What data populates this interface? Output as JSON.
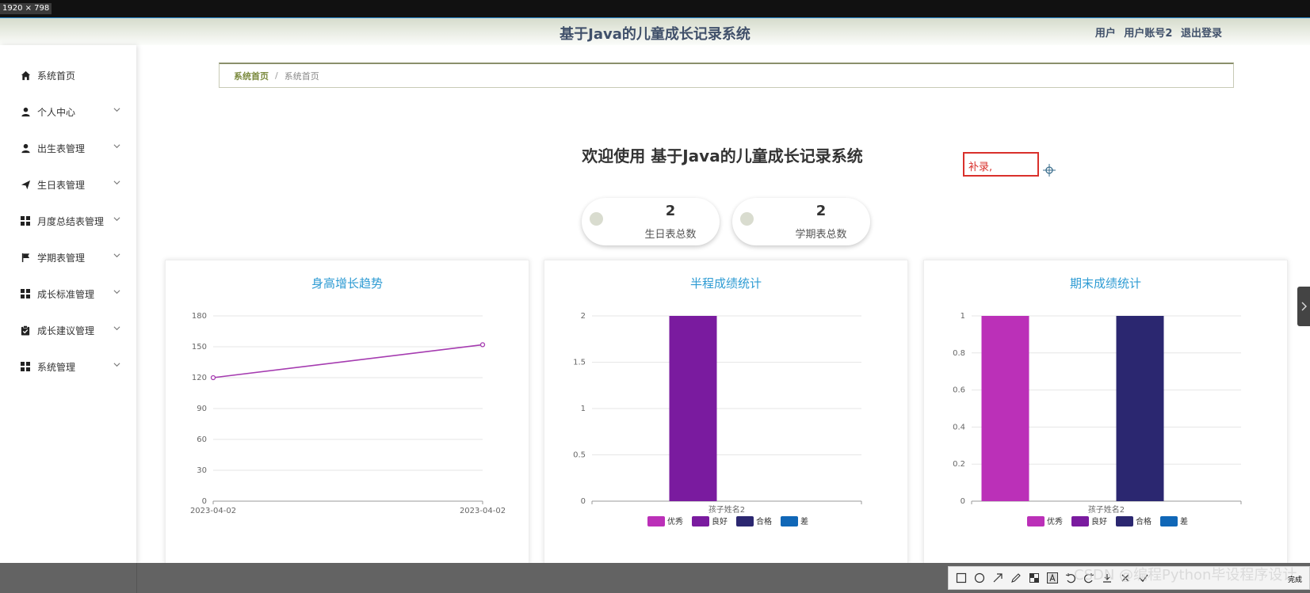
{
  "screen": {
    "size_label": "1920 × 798"
  },
  "header": {
    "title": "基于Java的儿童成长记录系统",
    "user_role": "用户",
    "user_account": "用户账号2",
    "logout": "退出登录"
  },
  "sidebar": {
    "items": [
      {
        "label": "系统首页",
        "icon": "home-icon"
      },
      {
        "label": "个人中心",
        "icon": "user-icon"
      },
      {
        "label": "出生表管理",
        "icon": "user-icon"
      },
      {
        "label": "生日表管理",
        "icon": "send-icon"
      },
      {
        "label": "月度总结表管理",
        "icon": "grid-icon"
      },
      {
        "label": "学期表管理",
        "icon": "flag-icon"
      },
      {
        "label": "成长标准管理",
        "icon": "grid-icon"
      },
      {
        "label": "成长建议管理",
        "icon": "clipboard-check-icon"
      },
      {
        "label": "系统管理",
        "icon": "grid-icon"
      }
    ]
  },
  "breadcrumb": {
    "home": "系统首页",
    "separator": "/",
    "current": "系统首页"
  },
  "welcome": "欢迎使用 基于Java的儿童成长记录系统",
  "annotation_note": "补录,",
  "stats": [
    {
      "value": "2",
      "label": "生日表总数"
    },
    {
      "value": "2",
      "label": "学期表总数"
    }
  ],
  "colors": {
    "legend": [
      "#bb30b8",
      "#7a1b9f",
      "#2b2770",
      "#1067b7"
    ],
    "line": "#a53bb0",
    "title": "#2d9bd3"
  },
  "chart_data": [
    {
      "type": "line",
      "title": "身高增长趋势",
      "x": [
        "2023-04-02",
        "2023-04-02"
      ],
      "series": [
        {
          "values": [
            120,
            152
          ]
        }
      ],
      "ylim": [
        0,
        180
      ],
      "yticks": [
        0,
        30,
        60,
        90,
        120,
        150,
        180
      ],
      "grid": true
    },
    {
      "type": "bar",
      "title": "半程成绩统计",
      "categories": [
        "孩子姓名2"
      ],
      "series": [
        {
          "name": "优秀",
          "values": [
            0
          ]
        },
        {
          "name": "良好",
          "values": [
            2
          ]
        },
        {
          "name": "合格",
          "values": [
            0
          ]
        },
        {
          "name": "差",
          "values": [
            0
          ]
        }
      ],
      "ylim": [
        0,
        2
      ],
      "yticks": [
        "0",
        "0.5",
        "1",
        "1.5",
        "2"
      ],
      "legend": "bottom",
      "grid": true
    },
    {
      "type": "bar",
      "title": "期末成绩统计",
      "categories": [
        "孩子姓名2"
      ],
      "series": [
        {
          "name": "优秀",
          "values": [
            1
          ]
        },
        {
          "name": "良好",
          "values": [
            0
          ]
        },
        {
          "name": "合格",
          "values": [
            1
          ]
        },
        {
          "name": "差",
          "values": [
            0
          ]
        }
      ],
      "ylim": [
        0,
        1
      ],
      "yticks": [
        "0",
        "0.2",
        "0.4",
        "0.6",
        "0.8",
        "1"
      ],
      "legend": "bottom",
      "grid": true
    }
  ],
  "bottom": {
    "watermark": "CSDN @编程Python毕设程序设计",
    "finish": "完成",
    "tools": [
      "rectangle-icon",
      "ellipse-icon",
      "arrow-icon",
      "pen-icon",
      "mosaic-icon",
      "text-icon",
      "undo-icon",
      "redo-icon",
      "save-icon",
      "close-icon",
      "finish-icon"
    ]
  }
}
